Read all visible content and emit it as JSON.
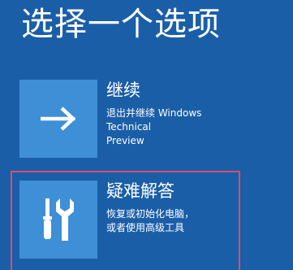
{
  "page": {
    "title": "选择一个选项"
  },
  "options": [
    {
      "heading": "继续",
      "desc_line1": "退出并继续 Windows Technical",
      "desc_line2": "Preview",
      "icon": "arrow-right-icon"
    },
    {
      "heading": "疑难解答",
      "desc_line1": "恢复或初始化电脑，",
      "desc_line2": "或者使用高级工具",
      "icon": "tools-icon"
    }
  ],
  "colors": {
    "background": "#1b5ea8",
    "tile": "#3e8fd6",
    "text": "#ffffff",
    "selection_frame": "#d64e6a"
  }
}
